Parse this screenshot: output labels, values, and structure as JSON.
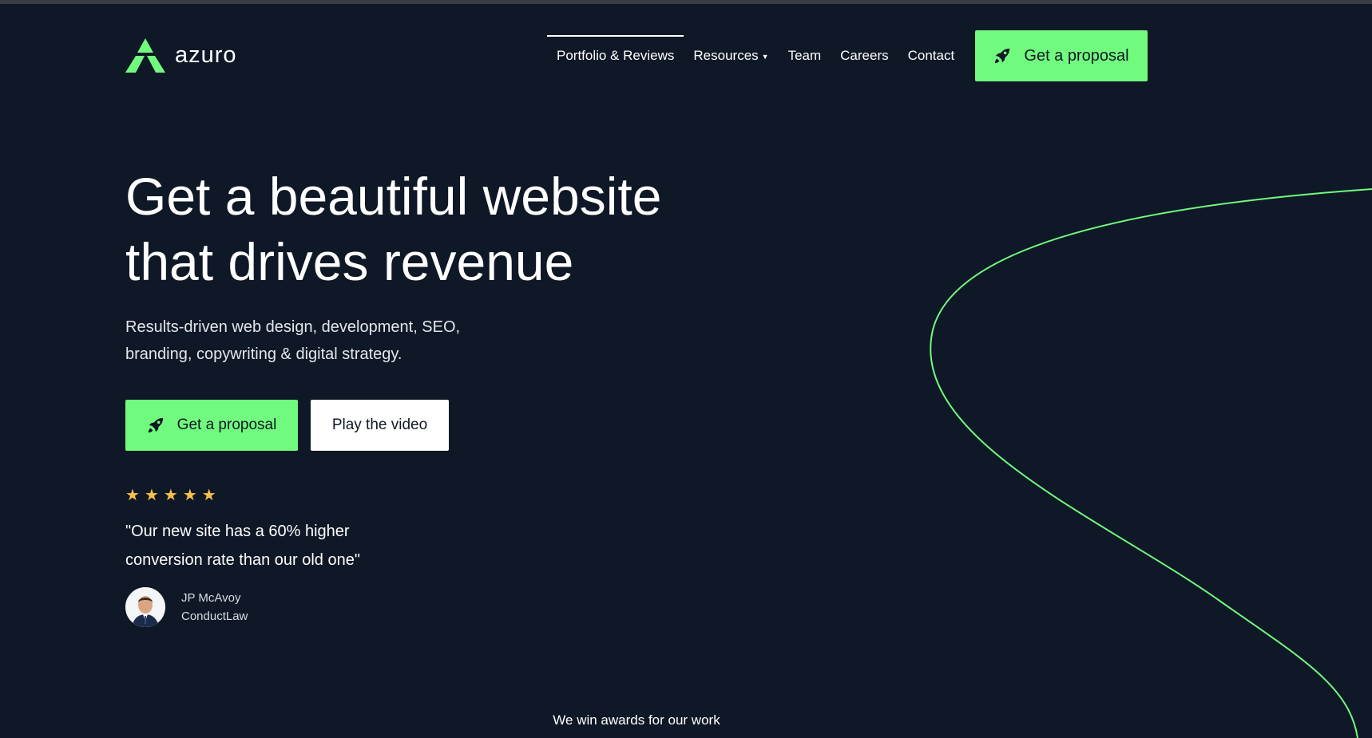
{
  "brand": {
    "name": "azuro",
    "accent": "#71fb7e",
    "background": "#0f1826",
    "star_color": "#f8c04b"
  },
  "nav": {
    "items": [
      {
        "label": "Portfolio & Reviews",
        "active": true
      },
      {
        "label": "Resources",
        "has_dropdown": true
      },
      {
        "label": "Team"
      },
      {
        "label": "Careers"
      },
      {
        "label": "Contact"
      }
    ],
    "cta_label": "Get a proposal",
    "cta_icon": "rocket-icon"
  },
  "hero": {
    "title_line1": "Get a beautiful website",
    "title_line2": "that drives revenue",
    "subtitle_line1": "Results-driven web design, development, SEO,",
    "subtitle_line2": "branding, copywriting & digital strategy.",
    "primary_cta": "Get a proposal",
    "secondary_cta": "Play the video"
  },
  "testimonial": {
    "rating": 5,
    "rating_max": 5,
    "star_glyph": "★",
    "quote_line1": "\"Our new site has a 60% higher",
    "quote_line2": "conversion rate than our old one\"",
    "author_name": "JP McAvoy",
    "author_company": "ConductLaw"
  },
  "awards": {
    "heading": "We win awards for our work"
  }
}
